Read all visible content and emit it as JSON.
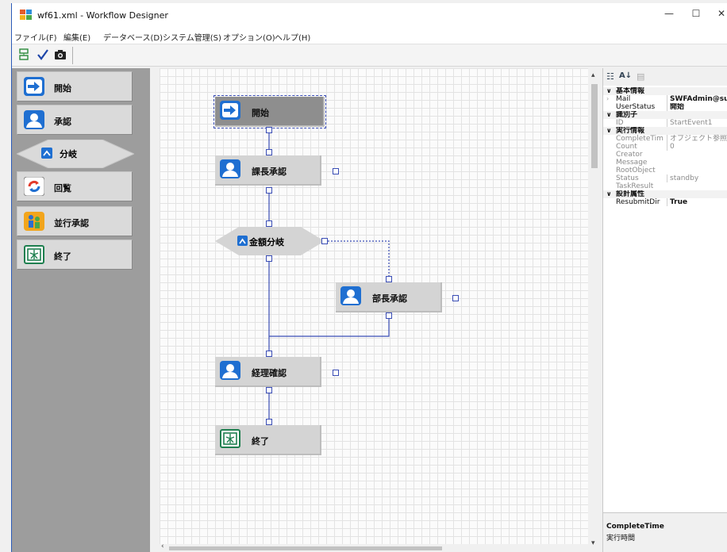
{
  "window": {
    "title": "wf61.xml  - Workflow Designer",
    "minimize": "—",
    "maximize": "☐",
    "close": "✕"
  },
  "menu": [
    "ファイル(F)",
    "編集(E)",
    "データベース(D)",
    "システム管理(S)",
    "オプション(O)",
    "ヘルプ(H)"
  ],
  "toolbar": {
    "icons": [
      "layout-icon",
      "check-icon",
      "camera-icon"
    ]
  },
  "palette": [
    {
      "label": "開始",
      "icon": "arrow-right-icon"
    },
    {
      "label": "承認",
      "icon": "person-icon"
    },
    {
      "label": "分岐",
      "icon": "branch-icon"
    },
    {
      "label": "回覧",
      "icon": "circulation-icon"
    },
    {
      "label": "並行承認",
      "icon": "parallel-approval-icon"
    },
    {
      "label": "終了",
      "icon": "end-icon"
    }
  ],
  "flow": {
    "nodes": [
      {
        "id": "start",
        "label": "開始",
        "icon": "arrow-right-icon",
        "selected": true
      },
      {
        "id": "section-chief",
        "label": "課長承認",
        "icon": "person-icon"
      },
      {
        "id": "amount-branch",
        "label": "金額分岐",
        "icon": "branch-icon"
      },
      {
        "id": "dept-head",
        "label": "部長承認",
        "icon": "person-icon"
      },
      {
        "id": "accounting",
        "label": "経理確認",
        "icon": "person-icon"
      },
      {
        "id": "end",
        "label": "終了",
        "icon": "end-icon"
      }
    ]
  },
  "properties": {
    "groups": [
      {
        "name": "基本情報",
        "rows": [
          {
            "key": "Mail",
            "value": "SWFAdmin@su",
            "bold": true,
            "expander": "›"
          },
          {
            "key": "UserStatus",
            "value": "開始",
            "bold": true
          }
        ]
      },
      {
        "name": "識別子",
        "rows": [
          {
            "key": "ID",
            "value": "StartEvent1",
            "disabled": true
          }
        ]
      },
      {
        "name": "実行情報",
        "rows": [
          {
            "key": "CompleteTim",
            "value": "オブジェクト参照が",
            "disabled": true
          },
          {
            "key": "Count",
            "value": "0",
            "disabled": true
          },
          {
            "key": "Creator",
            "value": "",
            "disabled": true
          },
          {
            "key": "Message",
            "value": "",
            "disabled": true
          },
          {
            "key": "RootObject",
            "value": "",
            "disabled": true
          },
          {
            "key": "Status",
            "value": "standby",
            "disabled": true
          },
          {
            "key": "TaskResult",
            "value": "",
            "disabled": true
          }
        ]
      },
      {
        "name": "設計属性",
        "rows": [
          {
            "key": "ResubmitDir",
            "value": "True",
            "bold": true
          }
        ]
      }
    ],
    "description": {
      "title": "CompleteTime",
      "text": "実行時間"
    }
  },
  "colors": {
    "connector": "#3a4db5",
    "canvas_bg": "#fbfbfb",
    "palette_bg": "#9d9d9d",
    "icon_blue": "#1f6fd1"
  }
}
